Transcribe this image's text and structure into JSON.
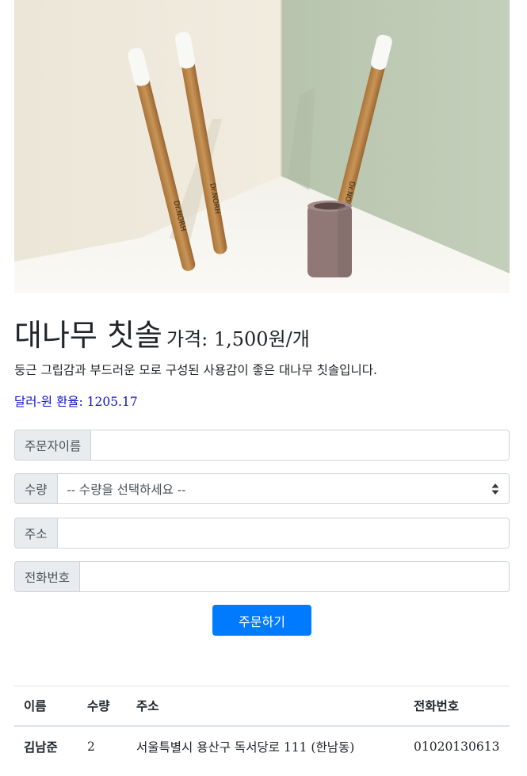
{
  "product": {
    "title": "대나무 칫솔",
    "price_label": "가격: 1,500원/개",
    "description": "둥근 그립감과 부드러운 모로 구성된 사용감이 좋은 대나무 칫솔입니다.",
    "exchange_rate": "달러-원 환율: 1205.17",
    "image_brand_text": "Dr.NORH"
  },
  "form": {
    "name_label": "주문자이름",
    "name_value": "",
    "quantity_label": "수량",
    "quantity_selected": "-- 수량을 선택하세요 --",
    "address_label": "주소",
    "address_value": "",
    "phone_label": "전화번호",
    "phone_value": "",
    "submit_label": "주문하기"
  },
  "table": {
    "headers": [
      "이름",
      "수량",
      "주소",
      "전화번호"
    ],
    "rows": [
      [
        "김남준",
        "2",
        "서울특별시 용산구 독서당로 111 (한남동)",
        "01020130613"
      ]
    ]
  },
  "colors": {
    "primary": "#007bff",
    "rate_text": "#1111cc",
    "addon_bg": "#e9ecef"
  }
}
